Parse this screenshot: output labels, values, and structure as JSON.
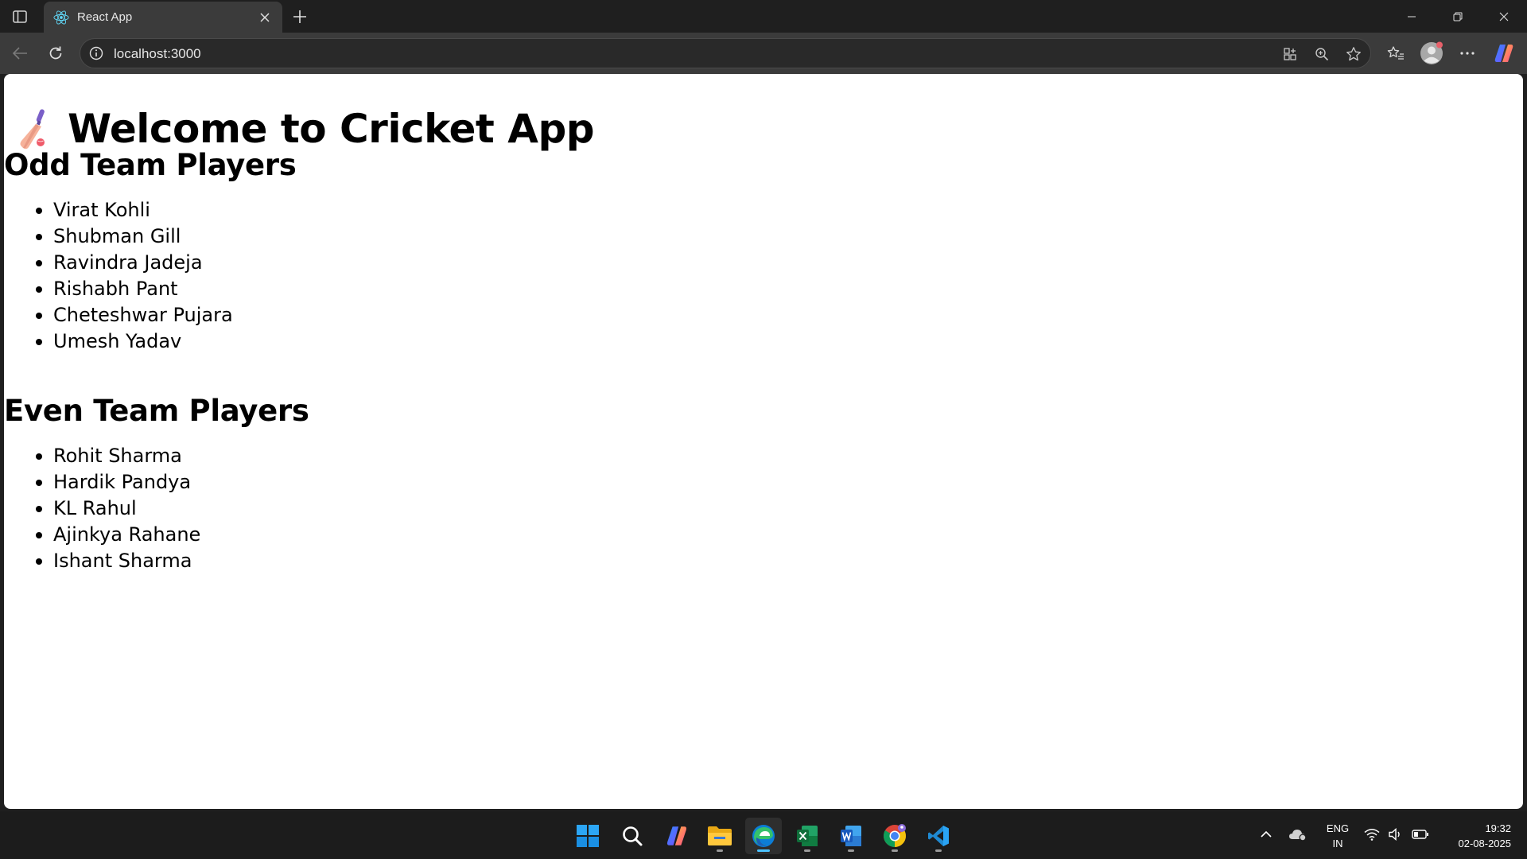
{
  "browser": {
    "tab_title": "React App",
    "url": "localhost:3000"
  },
  "page": {
    "emoji": "🏏",
    "title": "Welcome to Cricket App",
    "odd_team": {
      "heading": "Odd Team Players",
      "players": [
        "Virat Kohli",
        "Shubman Gill",
        "Ravindra Jadeja",
        "Rishabh Pant",
        "Cheteshwar Pujara",
        "Umesh Yadav"
      ]
    },
    "even_team": {
      "heading": "Even Team Players",
      "players": [
        "Rohit Sharma",
        "Hardik Pandya",
        "KL Rahul",
        "Ajinkya Rahane",
        "Ishant Sharma"
      ]
    }
  },
  "taskbar": {
    "apps": [
      "start",
      "search",
      "copilot",
      "file-explorer",
      "edge",
      "excel",
      "word",
      "chrome",
      "vscode"
    ],
    "active_app": "edge",
    "language": [
      "ENG",
      "IN"
    ],
    "time": "19:32",
    "date": "02-08-2025"
  },
  "colors": {
    "accent": "#4cc2ff",
    "tab_bg": "#3b3b3b",
    "frame_bg": "#1f1f1f"
  }
}
